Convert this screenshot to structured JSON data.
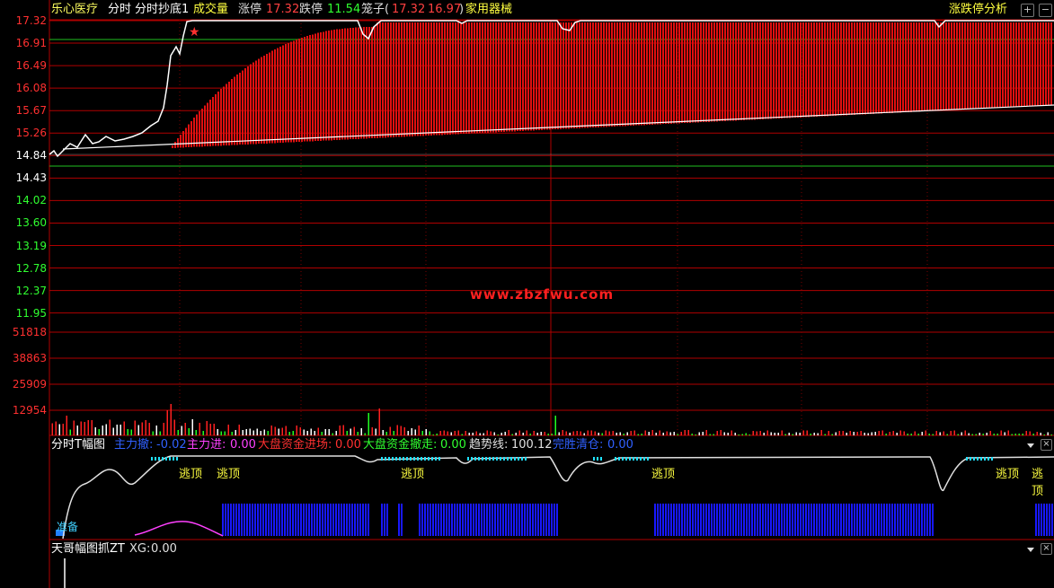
{
  "header": {
    "stock_name": "乐心医疗",
    "indicators": [
      "分时",
      "分时抄底1"
    ],
    "volume_label": "成交量",
    "limit_up_label": "涨停",
    "limit_up_value": "17.32",
    "limit_down_label": "跌停",
    "limit_down_value": "11.54",
    "cage_label": "笼子(",
    "cage_high": "17.32",
    "cage_low": "16.97",
    "cage_close": ")",
    "sector": "家用器械",
    "analysis_link": "涨跌停分析",
    "button_plus": "+",
    "button_minus": "−"
  },
  "price_axis": [
    "17.32",
    "16.91",
    "16.49",
    "16.08",
    "15.67",
    "15.26",
    "14.84",
    "14.43",
    "14.02",
    "13.60",
    "13.19",
    "12.78",
    "12.37",
    "11.95"
  ],
  "volume_axis": [
    "51818",
    "38863",
    "25909",
    "12954"
  ],
  "watermark": "www.zbzfwu.com",
  "panel1": {
    "title": "分时T幅图",
    "items": [
      {
        "label": "主力撤:",
        "value": "-0.02",
        "color": "#3060ff"
      },
      {
        "label": "主力进:",
        "value": "0.00",
        "color": "#ff40ff"
      },
      {
        "label": "大盘资金进场:",
        "value": "0.00",
        "color": "#ff3030"
      },
      {
        "label": "大盘资金撤走:",
        "value": "0.00",
        "color": "#30ff30"
      },
      {
        "label": "趋势线:",
        "value": "100.12",
        "color": "#e0e0e0"
      },
      {
        "label": "完胜清仓:",
        "value": "0.00",
        "color": "#3060ff"
      }
    ],
    "signals": [
      "逃顶",
      "逃顶",
      "逃顶",
      "逃顶",
      "逃顶",
      "逃顶"
    ],
    "zhunbei": "准备"
  },
  "panel2": {
    "title": "天哥幅图抓ZT",
    "xg_label": "XG:",
    "xg_value": "0.00"
  },
  "colors": {
    "grid_red": "#b00000",
    "price_line": "#ffffff",
    "avg_line": "#ffff00",
    "up": "#ff2020",
    "down": "#20ff20",
    "blue_bars": "#1818ff"
  }
}
